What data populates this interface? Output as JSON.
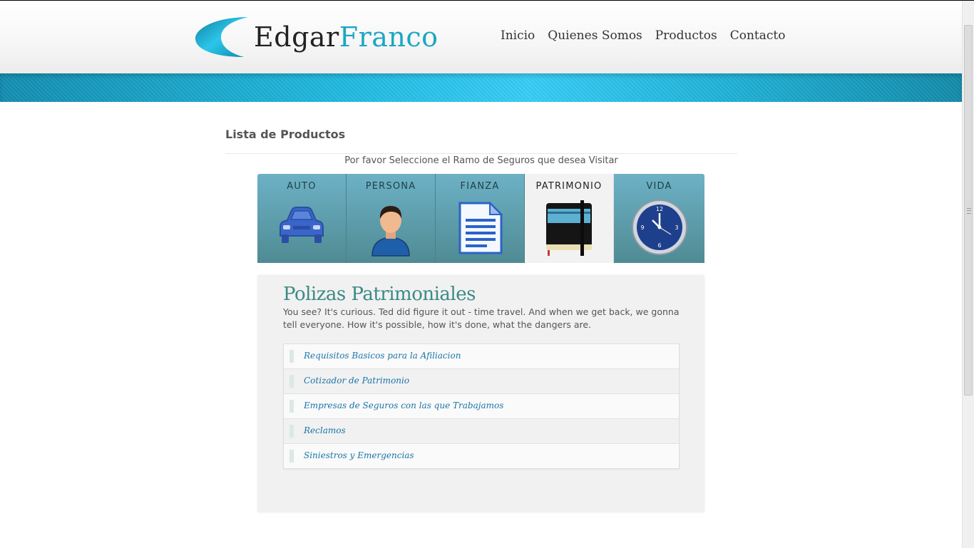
{
  "brand": {
    "first": "Edgar",
    "second": "Franco",
    "accent_color": "#1aa7c4"
  },
  "nav": [
    "Inicio",
    "Quienes Somos",
    "Productos",
    "Contacto"
  ],
  "page": {
    "title": "Lista de Productos",
    "instruction": "Por favor Seleccione el Ramo de Seguros que desea Visitar"
  },
  "tabs": [
    {
      "label": "AUTO",
      "icon": "car-icon"
    },
    {
      "label": "PERSONA",
      "icon": "person-icon"
    },
    {
      "label": "FIANZA",
      "icon": "document-icon"
    },
    {
      "label": "PATRIMONIO",
      "icon": "notebook-icon",
      "active": true
    },
    {
      "label": "VIDA",
      "icon": "clock-icon"
    }
  ],
  "panel": {
    "title": "Polizas Patrimoniales",
    "description": "You see? It's curious. Ted did figure it out - time travel. And when we get back, we gonna tell everyone. How it's possible, how it's done, what the dangers are.",
    "links": [
      "Requisitos Basicos para la Afiliacion",
      "Cotizador de Patrimonio",
      "Empresas de Seguros con las que Trabajamos",
      "Reclamos",
      "Siniestros y Emergencias"
    ]
  }
}
